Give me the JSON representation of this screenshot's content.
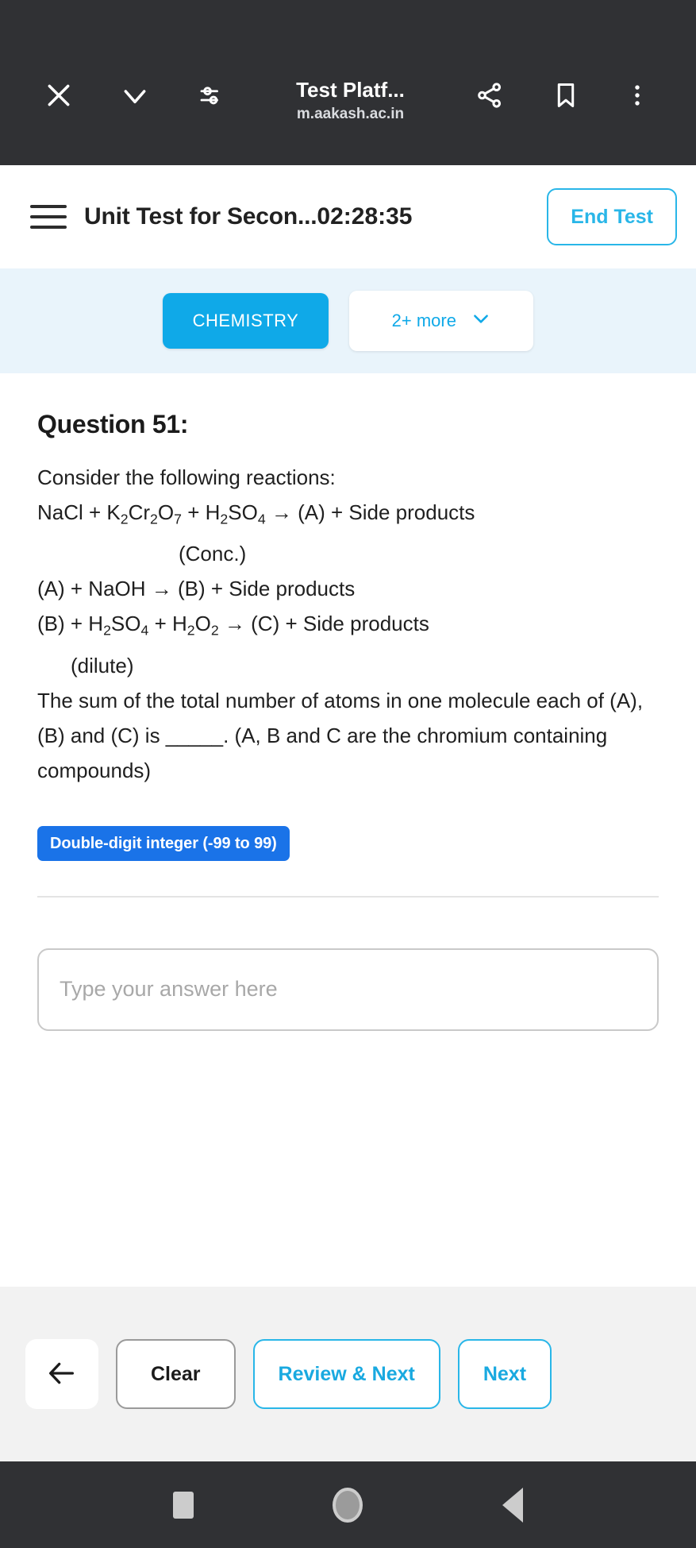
{
  "browser_bar": {
    "close_icon": "close-icon",
    "collapse_icon": "chevron-down-icon",
    "tune_icon": "tune-icon",
    "title": "Test Platf...",
    "url": "m.aakash.ac.in",
    "share_icon": "share-icon",
    "bookmark_icon": "bookmark-icon",
    "overflow_icon": "more-vertical-icon"
  },
  "header": {
    "menu_icon": "hamburger-menu-icon",
    "test_name": "Unit Test for Secon...",
    "timer": "02:28:35",
    "end_test_label": "End Test",
    "accent_color": "#29b6e8"
  },
  "tabs": {
    "active": "CHEMISTRY",
    "more_label": "2+ more",
    "more_caret_icon": "chevron-down-icon",
    "active_color": "#0fa9e8",
    "bar_background": "#e9f4fb"
  },
  "question": {
    "number_label": "Question 51:",
    "intro": "Consider the following reactions:",
    "reaction_1": "NaCl + K2Cr2O7 + H2SO4 → (A) + Side products",
    "reaction_1_note": "(Conc.)",
    "reaction_2": "(A) + NaOH → (B) + Side products",
    "reaction_3": "(B) + H2SO4 + H2O2 → (C) + Side products",
    "reaction_3_note": "(dilute)",
    "prompt": "The sum of the total number of atoms in one molecule each of (A), (B) and (C) is _____. (A, B and C are the chromium containing compounds)",
    "answer_type_badge": "Double-digit integer (-99 to 99)",
    "badge_color": "#1a73e8"
  },
  "answer": {
    "value": "",
    "placeholder": "Type your answer here"
  },
  "actions": {
    "back_icon": "arrow-left-icon",
    "clear_label": "Clear",
    "review_next_label": "Review & Next",
    "next_label": "Next"
  },
  "system_nav": {
    "recents_icon": "square-recents-icon",
    "home_icon": "circle-home-icon",
    "back_icon": "triangle-back-icon"
  }
}
